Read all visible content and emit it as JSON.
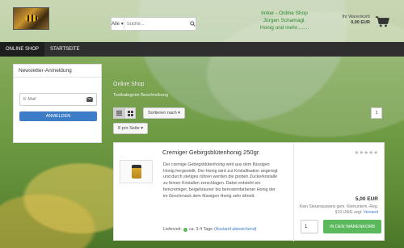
{
  "header": {
    "search": {
      "category": "Alle",
      "placeholder": "Suche..."
    },
    "tagline": [
      "Imker - Online Shop",
      "Jürgen Schamagl.",
      "Honig und mehr........"
    ],
    "cart": {
      "label": "Ihr Warenkorb",
      "amount": "0,00 EUR"
    }
  },
  "nav": {
    "items": [
      "ONLINE SHOP",
      "STARTSEITE"
    ]
  },
  "sidebar": {
    "title": "Newsletter-Anmeldung",
    "email_placeholder": "E-Mail",
    "button": "ANMELDEN"
  },
  "main": {
    "title": "Online Shop",
    "description": "Testkategorie Beschreibung",
    "sort_label": "Sortieren nach",
    "page_number": "1",
    "per_page_label": "8 pro Seite"
  },
  "product": {
    "title": "Cremiger Gebirgsblütenhonig 250gr.",
    "description": "Der cremige Gebirgsblütenhonig wird aus dem flüssigen Honig hergestellt. Der Honig wird zur Kristallisation angeregt und durch stetiges rühren werden die groben Zuckerkristalle zu feinen Kristallen zerschlagen. Dabei entsteht ein feincremiger, beigebrauner bis bernsteinfarbener Honig der im Geschmack dem flüssigen Honig sehr ähnelt.",
    "delivery_label": "Lieferzeit:",
    "delivery_time": "ca. 3-4 Tage",
    "delivery_link": "(Ausland abweichend)",
    "stars": "★★★★★",
    "price": "5,00 EUR",
    "price_note_1": "Kein Steuerausweis gem. Kleinuntern.-Reg.",
    "price_note_2": "§19 UStG zzgl.",
    "price_note_link": "Versand",
    "quantity": "1",
    "cart_button": "IN DEN WARENKORB"
  },
  "colors": {
    "accent_blue": "#3d7dc8",
    "cart_green": "#5cb85c",
    "nav_dark": "#2f2f2f",
    "tagline_green": "#2e8b2e"
  }
}
